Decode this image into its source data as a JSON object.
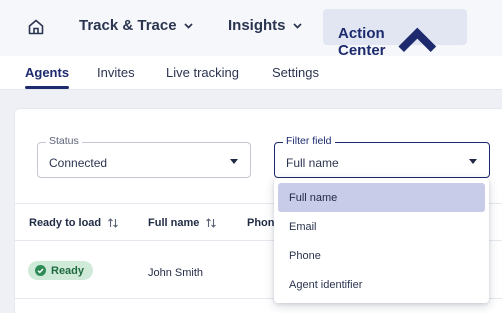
{
  "topnav": {
    "home_icon": "home-icon",
    "items": [
      {
        "label": "Track & Trace"
      },
      {
        "label": "Insights"
      },
      {
        "label": "Action Center"
      }
    ]
  },
  "subtabs": [
    "Agents",
    "Invites",
    "Live tracking",
    "Settings"
  ],
  "filters": {
    "status": {
      "legend": "Status",
      "value": "Connected"
    },
    "filter_field": {
      "legend": "Filter field",
      "value": "Full name"
    }
  },
  "table": {
    "headers": [
      "Ready to load",
      "Full name",
      "Phone"
    ],
    "rows": [
      {
        "status": "Ready",
        "full_name": "John Smith"
      }
    ]
  },
  "dropdown": {
    "options": [
      "Full name",
      "Email",
      "Phone",
      "Agent identifier"
    ],
    "selected": "Full name"
  },
  "colors": {
    "accent": "#1d2b6e",
    "ready_badge_bg": "#cfead9",
    "ready_badge_text": "#1f6b3f",
    "selected_option_bg": "#c9cce8"
  }
}
